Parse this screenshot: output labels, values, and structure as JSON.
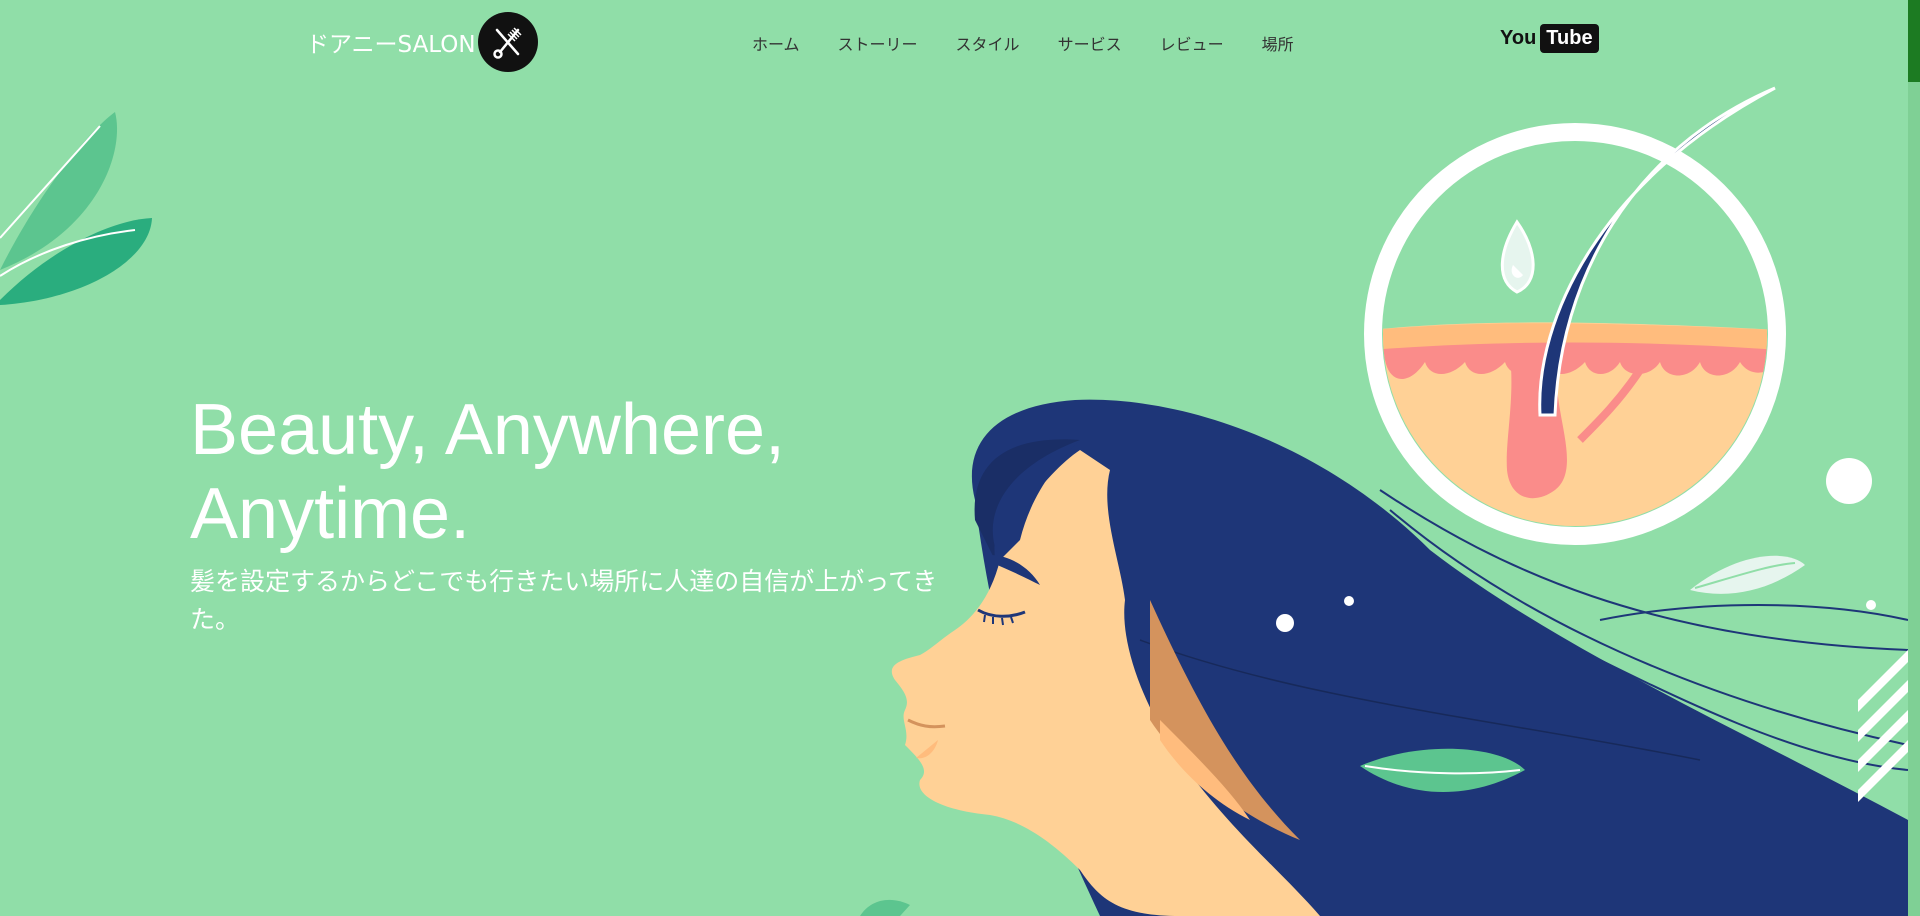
{
  "header": {
    "logo_text": "ドアニーSALON",
    "logo_icon": "scissors-comb-icon",
    "nav": [
      {
        "label": "ホーム"
      },
      {
        "label": "ストーリー"
      },
      {
        "label": "スタイル"
      },
      {
        "label": "サービス"
      },
      {
        "label": "レビュー"
      },
      {
        "label": "場所"
      }
    ],
    "youtube": {
      "you": "You",
      "tube": "Tube"
    }
  },
  "hero": {
    "title_line1": "Beauty, Anywhere,",
    "title_line2": "Anytime.",
    "subtitle": "髪を設定するからどこでも行きたい場所に人達の自信が上がってきた。"
  },
  "colors": {
    "background": "#90dea8",
    "hair": "#1e3678",
    "skin": "#ffd196",
    "leaf": "#2aad7e",
    "scroll_thumb": "#1c7b22"
  }
}
